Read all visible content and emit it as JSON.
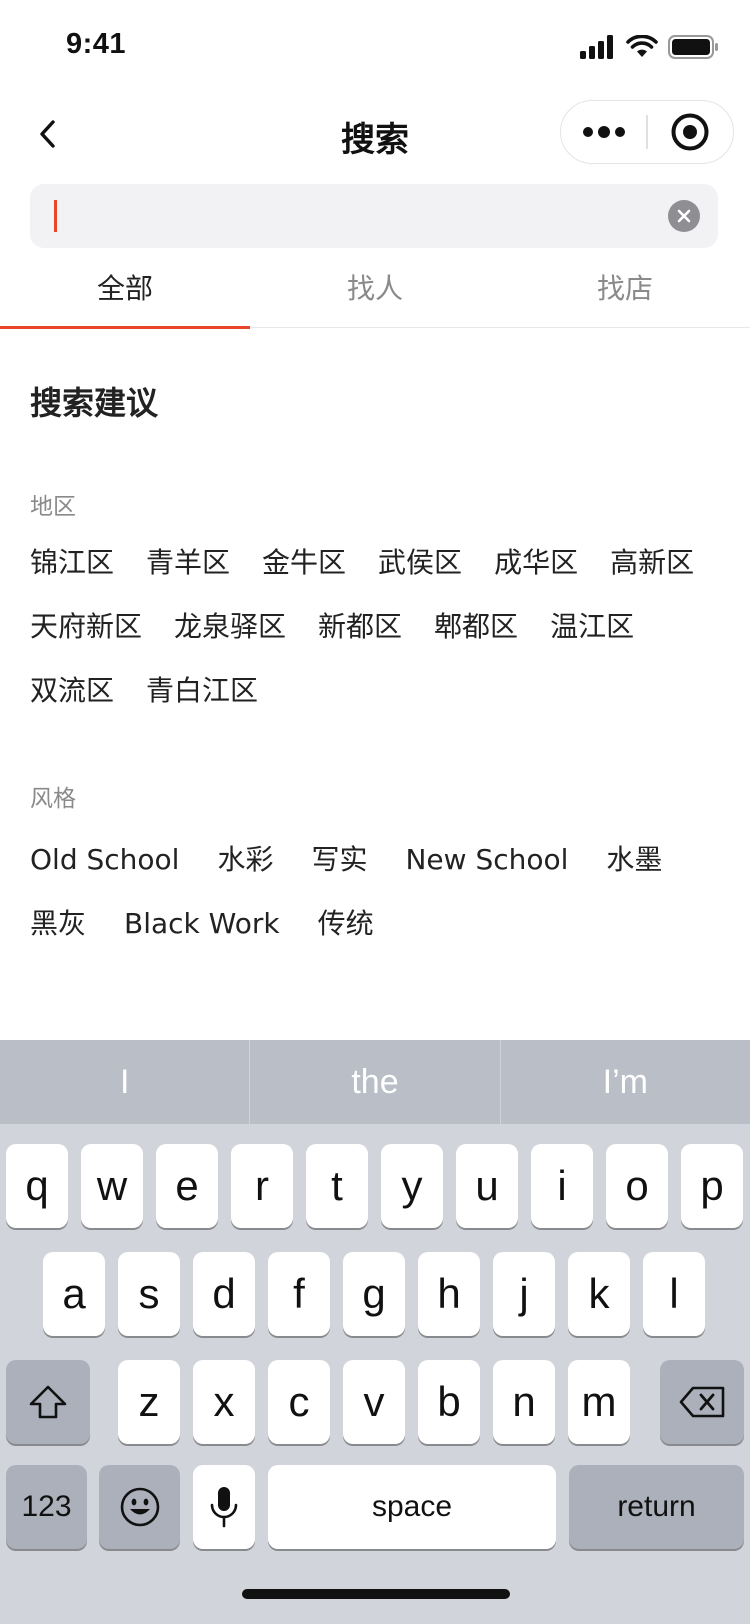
{
  "status": {
    "time": "9:41"
  },
  "nav": {
    "title": "搜索"
  },
  "search": {
    "value": "",
    "placeholder": ""
  },
  "tabs": [
    {
      "label": "全部",
      "active": true
    },
    {
      "label": "找人",
      "active": false
    },
    {
      "label": "找店",
      "active": false
    }
  ],
  "suggestions": {
    "title": "搜索建议",
    "region": {
      "label": "地区",
      "items": [
        "锦江区",
        "青羊区",
        "金牛区",
        "武侯区",
        "成华区",
        "高新区",
        "天府新区",
        "龙泉驿区",
        "新都区",
        "郫都区",
        "温江区",
        "双流区",
        "青白江区"
      ]
    },
    "style": {
      "label": "风格",
      "items": [
        "Old School",
        "水彩",
        "写实",
        "New School",
        "水墨",
        "黑灰",
        "Black Work",
        "传统"
      ]
    }
  },
  "keyboard": {
    "predictions": [
      "I",
      "the",
      "I’m"
    ],
    "row1": [
      "q",
      "w",
      "e",
      "r",
      "t",
      "y",
      "u",
      "i",
      "o",
      "p"
    ],
    "row2": [
      "a",
      "s",
      "d",
      "f",
      "g",
      "h",
      "j",
      "k",
      "l"
    ],
    "row3": [
      "z",
      "x",
      "c",
      "v",
      "b",
      "n",
      "m"
    ],
    "numbers_label": "123",
    "space_label": "space",
    "return_label": "return"
  },
  "colors": {
    "accent": "#e8452b",
    "keyboard_bg": "#d1d4da",
    "search_bg": "#f2f2f4"
  }
}
